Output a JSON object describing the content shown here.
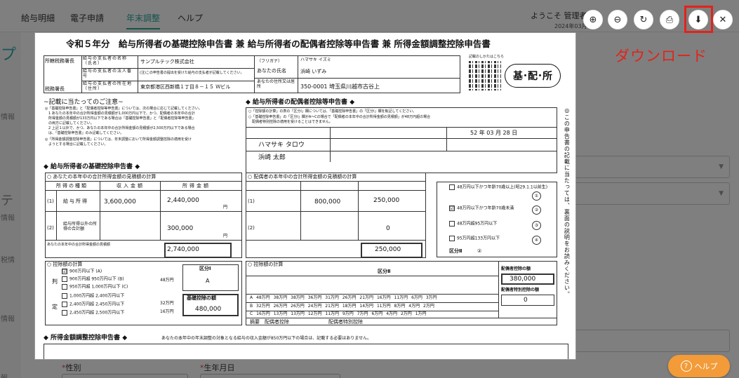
{
  "nav": {
    "items": [
      "給与明細",
      "電子申請",
      "年末調整",
      "ヘルプ"
    ],
    "welcome": "ようこそ 管理者",
    "date": "2024年03月"
  },
  "sidebar": {
    "labels": [
      "プ",
      "情報",
      "テ",
      "情報",
      "税情",
      "情報",
      "報"
    ]
  },
  "background": {
    "field_gender": "性別",
    "field_birthday": "生年月日",
    "required_mark": "*"
  },
  "toolbar": {
    "zoom_in": "⊕",
    "zoom_out": "⊖",
    "rotate": "↻",
    "print": "⎙",
    "download": "⬇",
    "close": "✕",
    "download_label": "ダウンロード"
  },
  "help": {
    "icon": "?",
    "label": "ヘルプ"
  },
  "document": {
    "title": "令和５年分　給与所得者の基礎控除申告書 兼 給与所得者の配偶者控除等申告書 兼 所得金額調整控除申告書",
    "header": {
      "office": "所轄税務署長",
      "employer_name_label": "給与の支払者の名称（氏名）",
      "employer_name": "サンプルテック株式会社",
      "corp_no_label": "給与の支払者の法人番号",
      "corp_no_note": "(注)この申告書の提出を受けた給与の支払者が記載してください。",
      "addr_label": "給与の支払者の所在地（住所）",
      "employer_addr": "東京都港区西新橋１丁目８－１５ Ｗビル",
      "tax_office": "税務署長",
      "furigana_label": "（フリガナ）",
      "name_label": "あなたの氏名",
      "furigana": "ハマサキ イズミ",
      "name": "浜崎 いずみ",
      "your_addr_label": "あなたの住所又は居所",
      "your_addr": "350-0001 埼玉県川越市古谷上",
      "qr_caption": "記載のしかたはこちら",
      "stamp": "基･配･所"
    },
    "left": {
      "heading": "~記載に当たってのご注意~",
      "notes": [
        "◎「基礎控除申告書」と「配偶者控除等申告書」については、次の場合に応じて記載してください。",
        "　1 あなたの本年中の合計所得金額の見積額が1,000万円以下で、かつ、配偶者の本年中の合計",
        "　所得金額の見積額が133万円以下である場合は「基礎控除申告書」と「配偶者控除等申告書」",
        "　の両方に記載してください。",
        "　2 上記１以外で、かつ、あなたの本年中の合計所得金額の見積額が2,500万円以下である場合",
        "　は、「基礎控除申告書」のみ記載してください。",
        "◎「所得金額調整控除申告書」については、年末調整において所得金額調整控除の適用を受け",
        "　ようとする場合に記載してください。"
      ],
      "basic_heading": "◆ 給与所得者の基礎控除申告書 ◆",
      "calc_title": "○ あなたの本年中の合計所得金額の見積額の計算",
      "col_type": "所得の種類",
      "col_income": "収入金額",
      "col_amount": "所得金額",
      "row1_label": "給与所得",
      "row1_income": "3,600,000",
      "row1_amount": "2,440,000",
      "row2_label": "給与所得以外の所得の合計額",
      "row2_amount": "300,000",
      "total_label": "あなたの本年中の合計所得金額の見積額",
      "total_amount": "2,740,000",
      "yen": "円",
      "ded_title": "○ 控除額の計算",
      "ded_rows": [
        "900万円以下",
        "900万円超 950万円以下",
        "950万円超 1,000万円以下",
        "1,000万円超 2,400万円以下",
        "2,400万円超 2,450万円以下",
        "2,450万円超 2,500万円以下"
      ],
      "ded_marks": [
        "(A)",
        "(B)",
        "(C)",
        "",
        "",
        ""
      ],
      "ded_vals": [
        "48万円",
        "32万円",
        "16万円"
      ],
      "kubun1": "区分Ⅰ",
      "kubun1_val": "A",
      "basic_ded_label": "基礎控除の額",
      "basic_ded_amount": "480,000",
      "hantei": "判",
      "tei": "定"
    },
    "right": {
      "heading": "◆ 給与所得者の配偶者控除等申告書 ◆",
      "notes": [
        "○「控除額の計算」の表の「区分Ⅰ」欄については、「基礎控除申告書」の「区分Ⅰ」欄を転記してください。",
        "○「基礎控除申告書」の「区分Ⅰ」欄がA～Cの場合で「配偶者の本年中の合計所得金額の見積額」が48万円超の場合",
        "　配偶者特別控除の適用を受けることはできません。"
      ],
      "sp_furigana": "ハマサキ タロウ",
      "sp_name": "浜崎 太郎",
      "sp_birth": "52 年 03 月 28 日",
      "calc_title": "○ 配偶者の本年中の合計所得金額の見積額の計算",
      "row1_income": "800,000",
      "row1_amount": "250,000",
      "row2_amount": "0",
      "total_amount": "250,000",
      "judge_rows": [
        "48万円以下かつ年齢70歳以上(昭29.1.1以前生)",
        "48万円以下かつ年齢70歳未満",
        "48万円超95万円以下",
        "95万円超133万円以下"
      ],
      "judge_marks": [
        "①",
        "②",
        "③",
        "④"
      ],
      "kubun2": "区分Ⅱ",
      "kubun2_val": "②",
      "ded_title": "○ 控除額の計算",
      "ded_col": "区分Ⅱ",
      "tbl_a": [
        "A",
        "48万円",
        "38万円",
        "38万円",
        "36万円",
        "31万円",
        "26万円",
        "21万円",
        "16万円",
        "11万円",
        "6万円",
        "3万円"
      ],
      "tbl_b": [
        "B",
        "32万円",
        "26万円",
        "26万円",
        "24万円",
        "21万円",
        "18万円",
        "14万円",
        "11万円",
        "8万円",
        "4万円",
        "2万円"
      ],
      "tbl_c": [
        "C",
        "16万円",
        "13万円",
        "13万円",
        "12万円",
        "11万円",
        "9万円",
        "7万円",
        "6万円",
        "4万円",
        "2万円",
        "1万円"
      ],
      "summary": "摘要",
      "spouse_ded": "配偶者控除",
      "spouse_special": "配偶者特別控除",
      "spouse_ded_label": "配偶者控除の額",
      "spouse_ded_amount": "380,000",
      "spouse_special_label": "配偶者特別控除の額",
      "spouse_special_amount": "0"
    },
    "side_note": "◎この申告書の記載に当たっては、裏面の説明をお読みください。",
    "bottom_heading": "◆ 所得金額調整控除申告書 ◆",
    "bottom_note": "あなたの本年中の年末調整の対象となる給与の収入金額が850万円以下の場合は、記載する必要はありません。"
  }
}
